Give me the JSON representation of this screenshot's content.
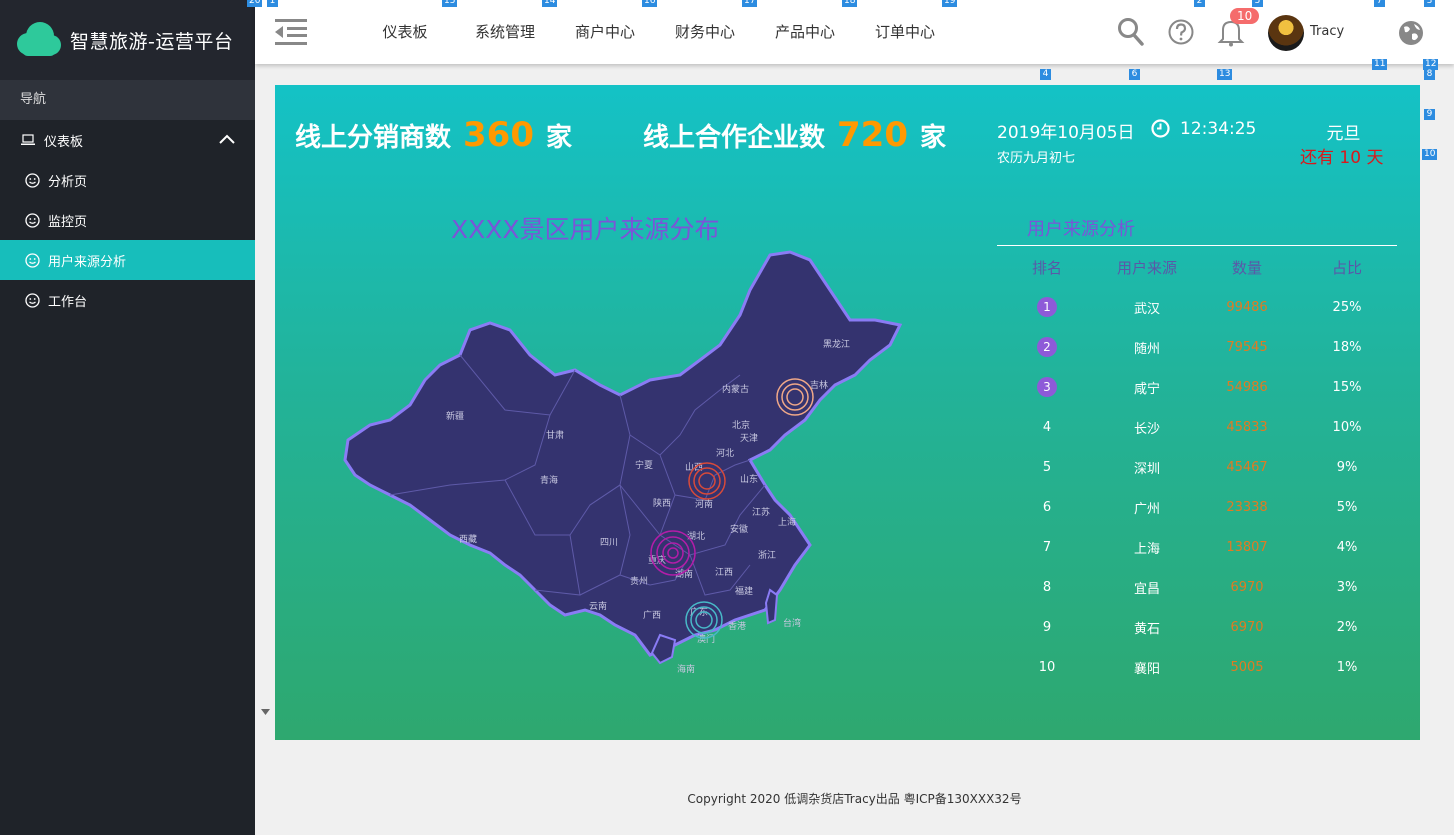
{
  "brand": {
    "title": "智慧旅游-运营平台"
  },
  "sidebar": {
    "heading": "导航",
    "parent_label": "仪表板",
    "items": [
      {
        "label": "分析页"
      },
      {
        "label": "监控页"
      },
      {
        "label": "用户来源分析",
        "active": true
      },
      {
        "label": "工作台"
      }
    ]
  },
  "topnav": [
    "仪表板",
    "系统管理",
    "商户中心",
    "财务中心",
    "产品中心",
    "订单中心"
  ],
  "header": {
    "notification_count": "10",
    "user_name": "Tracy"
  },
  "markers": [
    "20",
    "1",
    "15",
    "14",
    "16",
    "17",
    "18",
    "19",
    "2",
    "5",
    "7",
    "3",
    "4",
    "6",
    "13",
    "11",
    "12",
    "8",
    "9",
    "10"
  ],
  "stats": {
    "distributors_label": "线上分销商数",
    "distributors_value": "360",
    "distributors_unit": "家",
    "enterprises_label": "线上合作企业数",
    "enterprises_value": "720",
    "enterprises_unit": "家"
  },
  "datetime": {
    "date": "2019年10月05日",
    "time": "12:34:25",
    "lunar": "农历九月初七",
    "holiday": "元旦",
    "countdown": "还有 10 天"
  },
  "map": {
    "title": "XXXX景区用户来源分布",
    "provinces": [
      "黑龙江",
      "吉林",
      "内蒙古",
      "新疆",
      "甘肃",
      "北京",
      "天津",
      "河北",
      "宁夏",
      "山西",
      "山东",
      "青海",
      "陕西",
      "河南",
      "江苏",
      "上海",
      "西藏",
      "四川",
      "湖北",
      "安徽",
      "浙江",
      "重庆",
      "湖南",
      "贵州",
      "江西",
      "福建",
      "云南",
      "广西",
      "广东",
      "香港",
      "澳门",
      "台湾",
      "海南"
    ]
  },
  "table": {
    "title": "用户来源分析",
    "headers": [
      "排名",
      "用户来源",
      "数量",
      "占比"
    ],
    "rows": [
      {
        "rank": "1",
        "city": "武汉",
        "count": "99486",
        "ratio": "25%"
      },
      {
        "rank": "2",
        "city": "随州",
        "count": "79545",
        "ratio": "18%"
      },
      {
        "rank": "3",
        "city": "咸宁",
        "count": "54986",
        "ratio": "15%"
      },
      {
        "rank": "4",
        "city": "长沙",
        "count": "45833",
        "ratio": "10%"
      },
      {
        "rank": "5",
        "city": "深圳",
        "count": "45467",
        "ratio": "9%"
      },
      {
        "rank": "6",
        "city": "广州",
        "count": "23338",
        "ratio": "5%"
      },
      {
        "rank": "7",
        "city": "上海",
        "count": "13807",
        "ratio": "4%"
      },
      {
        "rank": "8",
        "city": "宜昌",
        "count": "6970",
        "ratio": "3%"
      },
      {
        "rank": "9",
        "city": "黄石",
        "count": "6970",
        "ratio": "2%"
      },
      {
        "rank": "10",
        "city": "襄阳",
        "count": "5005",
        "ratio": "1%"
      }
    ]
  },
  "footer": {
    "text": "Copyright  2020 低调杂货店Tracy出品  粤ICP备130XXX32号"
  },
  "colors": {
    "sidebar_bg": "#1f2329",
    "active": "#17bebb",
    "accent_orange": "#ff9900",
    "title_purple": "#7a55d8",
    "countdown_red": "#d9191c"
  }
}
